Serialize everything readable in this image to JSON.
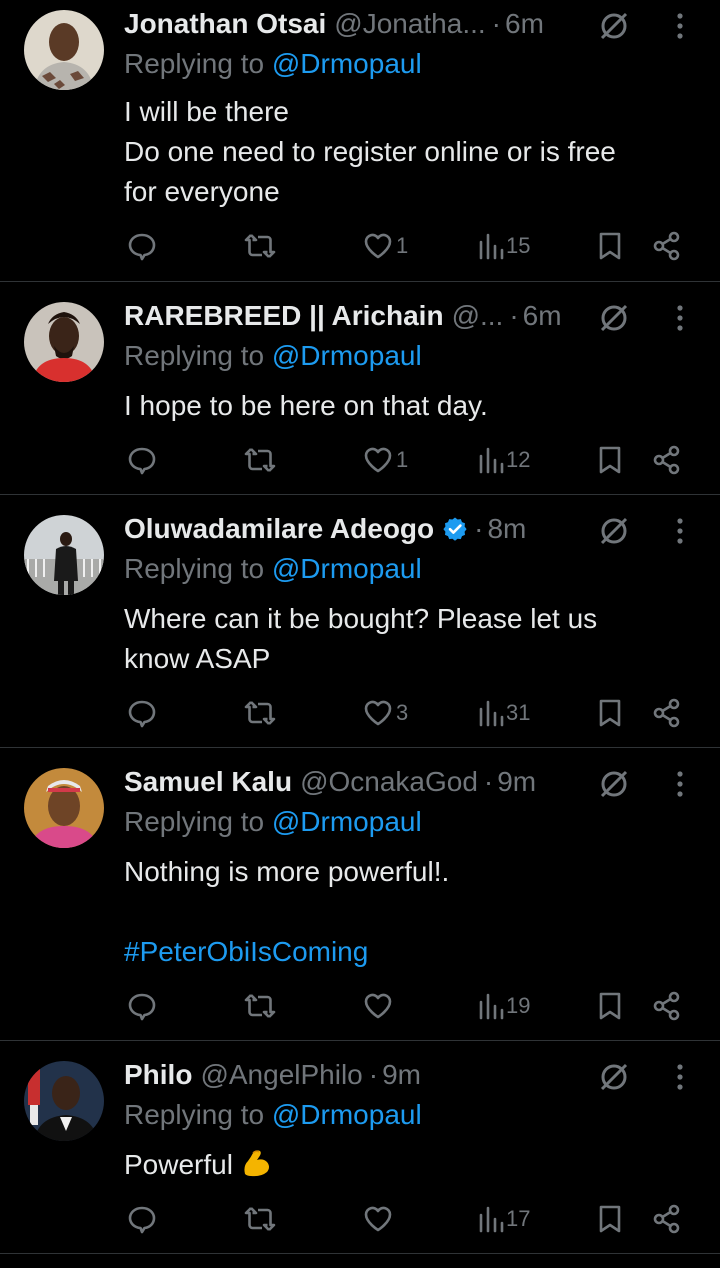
{
  "tweets": [
    {
      "name": "Jonathan Otsai",
      "handle": "@Jonatha...",
      "time": "6m",
      "replying_prefix": "Replying to",
      "mention": "@Drmopaul",
      "body": [
        "I will be there",
        "Do one need to register online or is free",
        "for everyone"
      ],
      "likes": "1",
      "views": "15"
    },
    {
      "name": "RAREBREED || Arichain",
      "handle": "@...",
      "time": "6m",
      "replying_prefix": "Replying to",
      "mention": "@Drmopaul",
      "body": [
        "I hope to be here on that day."
      ],
      "likes": "1",
      "views": "12"
    },
    {
      "name": "Oluwadamilare Adeogo",
      "handle": "",
      "time": "8m",
      "verified": true,
      "replying_prefix": "Replying to",
      "mention": "@Drmopaul",
      "body": [
        "Where can it be bought? Please let us",
        "know ASAP"
      ],
      "likes": "3",
      "views": "31"
    },
    {
      "name": "Samuel Kalu",
      "handle": "@OcnakaGod",
      "time": "9m",
      "replying_prefix": "Replying to",
      "mention": "@Drmopaul",
      "body": [
        "Nothing is more powerful!.",
        ""
      ],
      "hashtag": "#PeterObiIsComing",
      "likes": "",
      "views": "19"
    },
    {
      "name": "Philo",
      "handle": "@AngelPhilo",
      "time": "9m",
      "replying_prefix": "Replying to",
      "mention": "@Drmopaul",
      "body": [
        "Powerful"
      ],
      "emoji": "flexed-biceps",
      "likes": "",
      "views": "17"
    }
  ],
  "colors": {
    "background": "#000000",
    "text": "#e7e9ea",
    "muted": "#71767b",
    "link": "#1d9bf0",
    "divider": "#2f3336",
    "verified": "#1d9bf0"
  },
  "icons": [
    "reply-icon",
    "retweet-icon",
    "like-icon",
    "views-icon",
    "bookmark-icon",
    "share-icon",
    "grok-icon",
    "more-icon",
    "verified-icon"
  ]
}
